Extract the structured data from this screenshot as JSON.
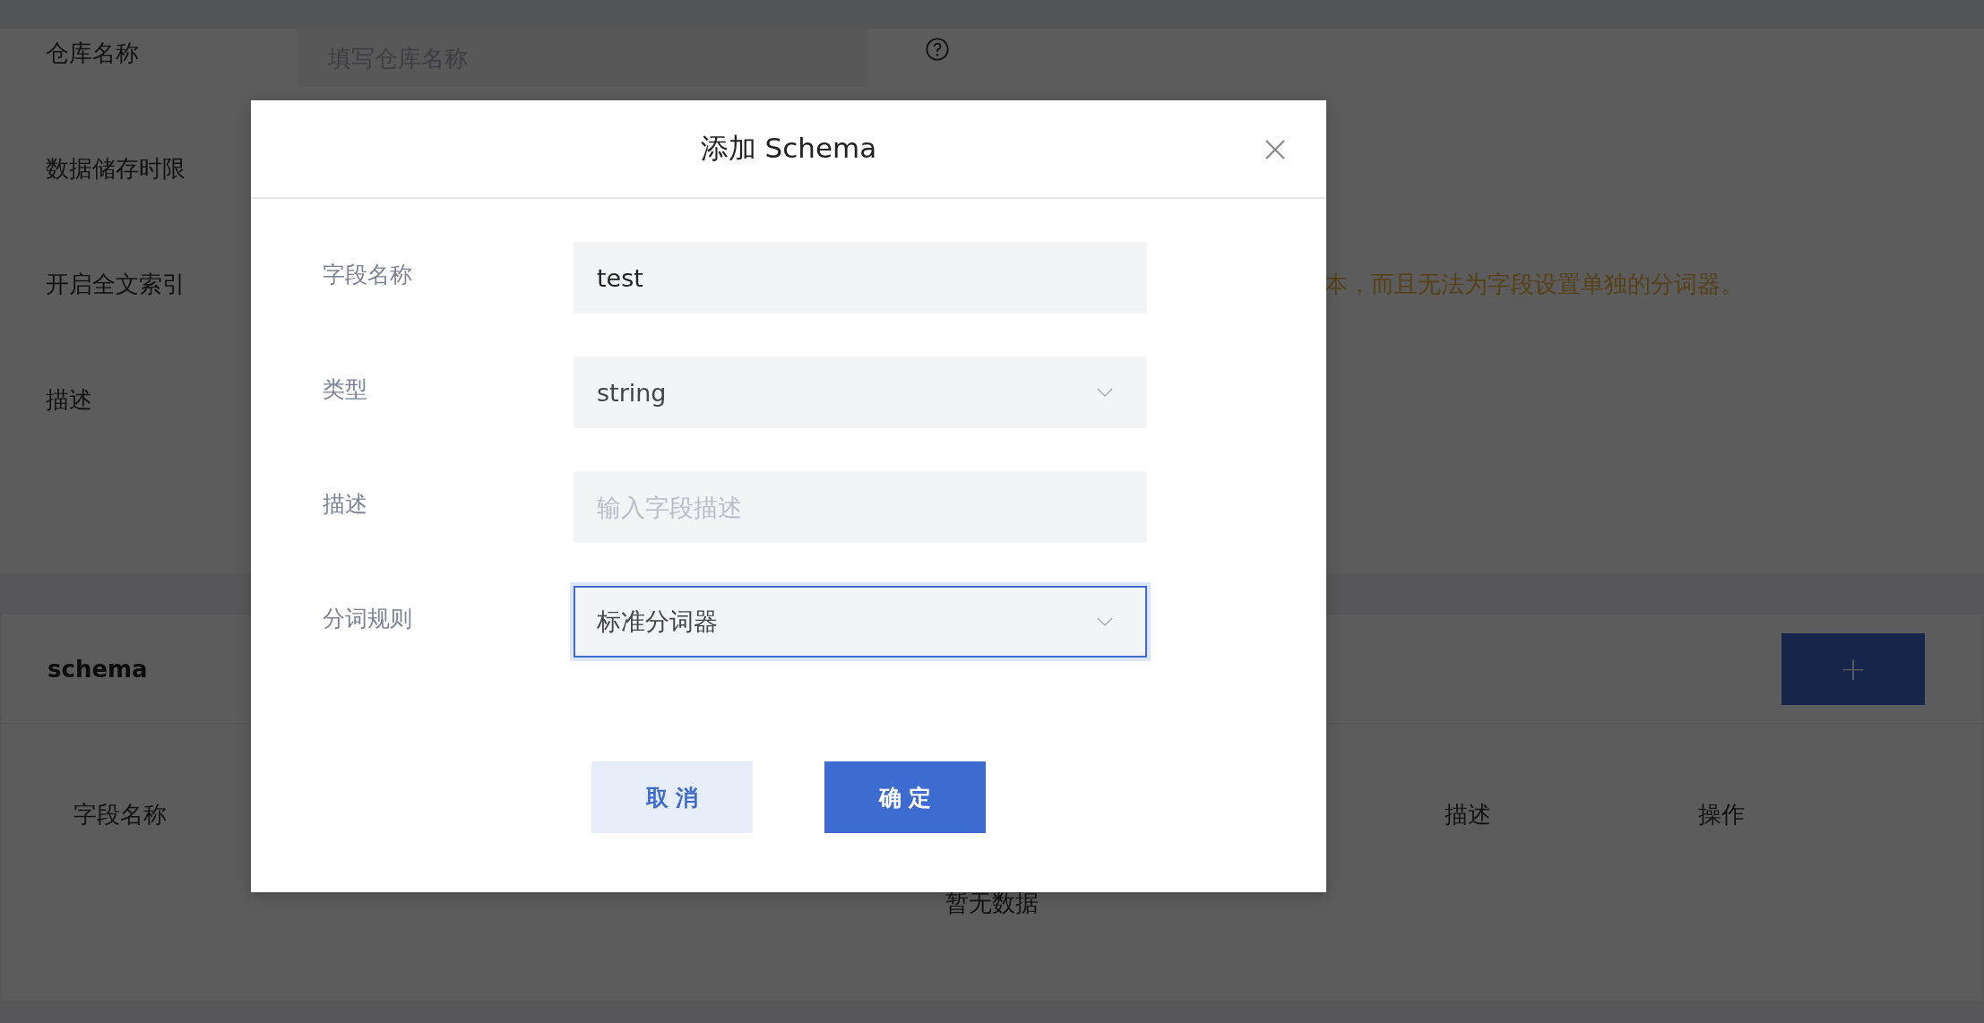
{
  "page": {
    "form_rows": [
      {
        "label": "仓库名称",
        "placeholder": "填写仓库名称",
        "help": true
      },
      {
        "label": "数据储存时限"
      },
      {
        "label": "开启全文索引",
        "note": "本，而且无法为字段设置单独的分词器。"
      },
      {
        "label": "描述"
      }
    ],
    "schema_section": {
      "title": "schema",
      "add_button": "+",
      "table_columns": [
        "字段名称",
        "描述",
        "操作"
      ],
      "empty_text": "暂无数据"
    }
  },
  "dialog": {
    "title": "添加 Schema",
    "fields": [
      {
        "label": "字段名称",
        "kind": "input",
        "value": "test",
        "focused": false
      },
      {
        "label": "类型",
        "kind": "select",
        "value": "string",
        "focused": false
      },
      {
        "label": "描述",
        "kind": "input",
        "placeholder": "输入字段描述",
        "focused": false
      },
      {
        "label": "分词规则",
        "kind": "select",
        "value": "标准分词器",
        "focused": true
      }
    ],
    "buttons": [
      {
        "label": "取 消",
        "kind": "secondary"
      },
      {
        "label": "确 定",
        "kind": "primary"
      }
    ]
  }
}
